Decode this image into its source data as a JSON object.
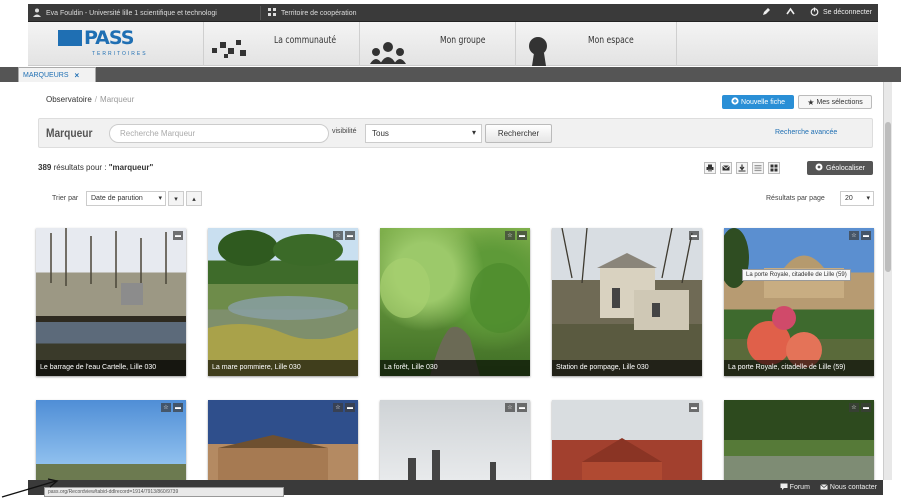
{
  "topbar": {
    "user": "Eva Fouldin - Université lille 1 scientifique et technologi",
    "territory": "Territoire de coopération",
    "logout": "Se déconnecter"
  },
  "header": {
    "logo_text": "PASS",
    "logo_sub": "TERRITOIRES",
    "nav": [
      "La communauté",
      "Mon groupe",
      "Mon espace"
    ]
  },
  "tab": {
    "label": "MARQUEURS",
    "close": "×"
  },
  "breadcrumb": {
    "root": "Observatoire",
    "separator": "/",
    "current": "Marqueur"
  },
  "buttons": {
    "new_sheet": "Nouvelle fiche",
    "my_selections": "Mes sélections",
    "search": "Rechercher",
    "geo": "Géolocaliser"
  },
  "search": {
    "title": "Marqueur",
    "placeholder": "Recherche Marqueur",
    "visibility_label": "visibilité",
    "visibility_value": "Tous",
    "advanced": "Recherche avancée"
  },
  "results": {
    "count": "389",
    "text": "résultats pour :",
    "query": "\"marqueur\""
  },
  "sort": {
    "label": "Trier par",
    "value": "Date de parution",
    "per_page_label": "Résultats par page",
    "per_page_value": "20"
  },
  "cards_row1": [
    {
      "caption": "Le barrage de l'eau Cartelle, Lille 030"
    },
    {
      "caption": "La mare pommiere, Lille 030"
    },
    {
      "caption": "La forêt, Lille 030"
    },
    {
      "caption": "Station de pompage, Lille 030"
    },
    {
      "caption": "La porte Royale, citadelle de Lille (59)"
    }
  ],
  "tooltip": "La porte Royale, citadelle de Lille (59)",
  "footer": {
    "forum": "Forum",
    "contact": "Nous contacter"
  },
  "status_url": "pass.org/Recordview/tabid-ddlrecord=1914/7913/860/9739",
  "colors": {
    "accent": "#1f6fb3",
    "primary_button": "#2a8fd6",
    "bar": "#3a3a3a"
  }
}
